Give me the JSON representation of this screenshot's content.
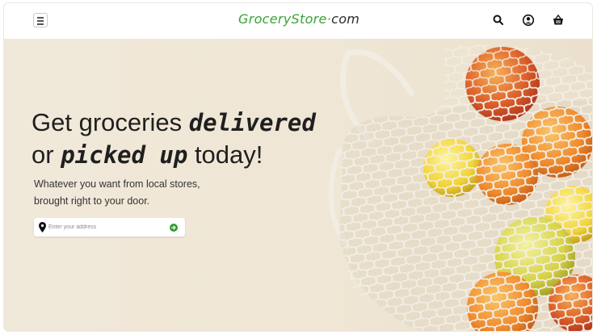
{
  "header": {
    "logo_brand": "GroceryStore",
    "logo_dot": "·",
    "logo_tld": "com",
    "menu_icon": "hamburger-menu-icon",
    "search_icon": "search-icon",
    "account_icon": "user-account-icon",
    "cart_icon": "shopping-basket-icon"
  },
  "hero": {
    "headline_part1": "Get groceries ",
    "headline_em1": "delivered",
    "headline_part2": "or ",
    "headline_em2": "picked up",
    "headline_part3": " today!",
    "subtext_line1": "Whatever you want from local stores,",
    "subtext_line2": "brought right to your door.",
    "address_placeholder": "Enter your address",
    "address_value": "",
    "pin_icon": "location-pin-icon",
    "submit_icon": "arrow-right-circle-icon"
  },
  "colors": {
    "brand_green": "#3aa335",
    "hero_bg": "#efe6d6",
    "text_dark": "#1f1f1f"
  }
}
